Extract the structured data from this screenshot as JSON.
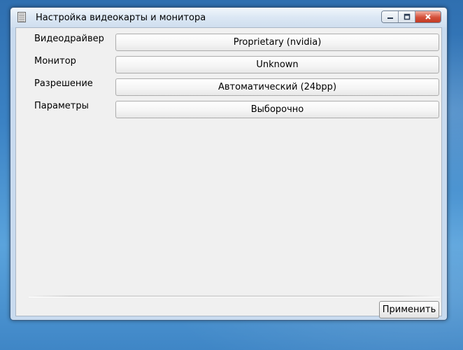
{
  "window": {
    "title": "Настройка видеокарты и монитора",
    "icon": "document-icon"
  },
  "rows": [
    {
      "label": "Видеодрайвер",
      "value": "Proprietary (nvidia)"
    },
    {
      "label": "Монитор",
      "value": "Unknown"
    },
    {
      "label": "Разрешение",
      "value": "Автоматический (24bpp)"
    },
    {
      "label": "Параметры",
      "value": "Выборочно"
    }
  ],
  "footer": {
    "apply_label": "Применить"
  },
  "colors": {
    "desktop": "#3b82c4",
    "panel": "#f0f0f0",
    "close_button": "#d4503a"
  }
}
